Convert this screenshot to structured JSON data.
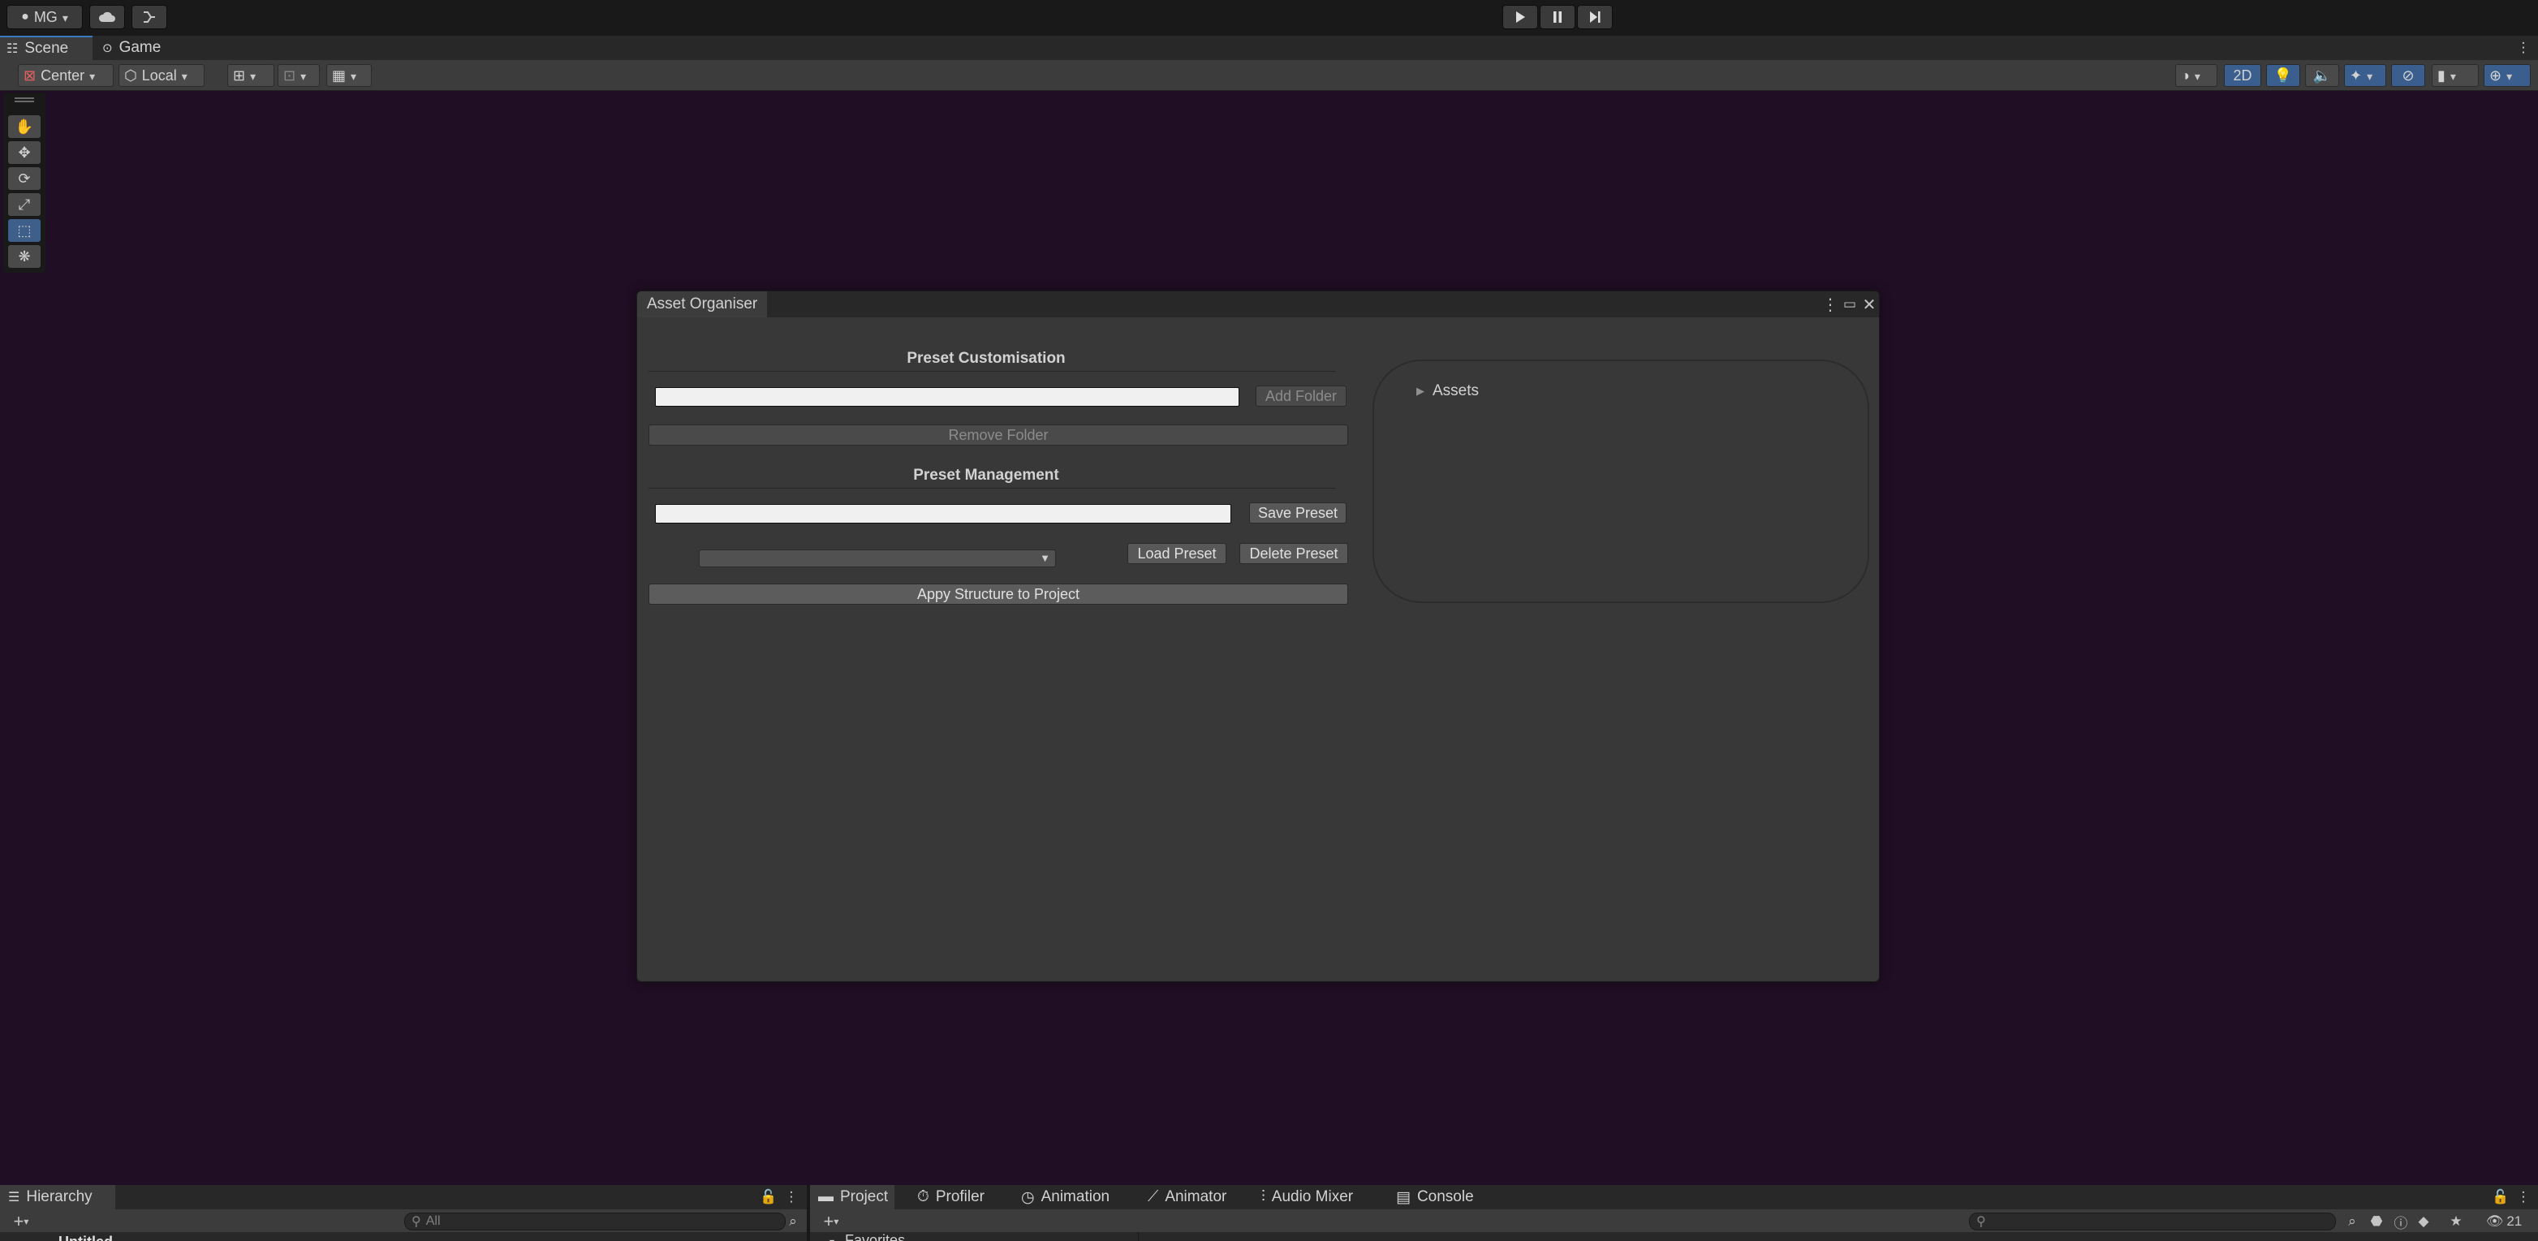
{
  "top_toolbar": {
    "account_label": "MG",
    "cloud_icon": "cloud-icon",
    "collab_icon": "branch-icon",
    "play_icon": "play-icon",
    "pause_icon": "pause-icon",
    "step_icon": "step-icon",
    "more_icon": "more-vertical-icon"
  },
  "scene_tabs": [
    {
      "label": "Scene",
      "icon": "grid-icon"
    },
    {
      "label": "Game",
      "icon": "gamepad-icon"
    }
  ],
  "scene_toolbar": {
    "pivot_label": "Center",
    "space_label": "Local",
    "mode_2d_label": "2D"
  },
  "window": {
    "title": "Asset Organiser",
    "preset_customisation": {
      "title": "Preset Customisation",
      "folder_input_value": "",
      "add_folder_label": "Add Folder",
      "remove_folder_label": "Remove Folder"
    },
    "preset_management": {
      "title": "Preset Management",
      "preset_name_value": "",
      "save_preset_label": "Save Preset",
      "preset_dropdown_value": "",
      "load_preset_label": "Load Preset",
      "delete_preset_label": "Delete Preset"
    },
    "apply_label": "Appy Structure to Project",
    "tree": {
      "root_label": "Assets"
    }
  },
  "hierarchy": {
    "tab_label": "Hierarchy",
    "search_placeholder": "All",
    "first_row": "Untitled"
  },
  "project_tabs": [
    {
      "label": "Project",
      "icon": "folder-icon"
    },
    {
      "label": "Profiler",
      "icon": "stopwatch-icon"
    },
    {
      "label": "Animation",
      "icon": "clock-icon"
    },
    {
      "label": "Animator",
      "icon": "animator-icon"
    },
    {
      "label": "Audio Mixer",
      "icon": "mixer-icon"
    },
    {
      "label": "Console",
      "icon": "console-icon"
    }
  ],
  "project": {
    "favorites_label": "Favorites",
    "visible_count": "21"
  }
}
